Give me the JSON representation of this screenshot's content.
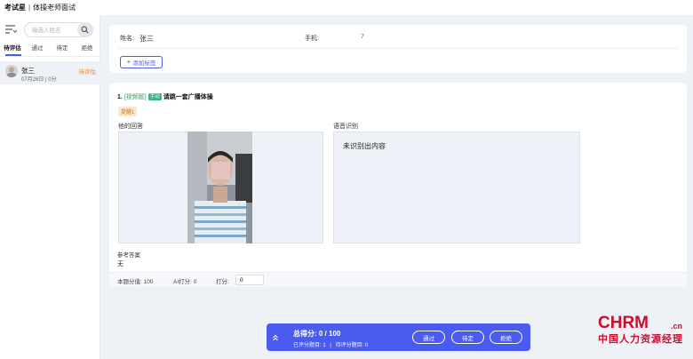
{
  "header": {
    "app_title": "考试星",
    "separator": "|",
    "exam_title": "体操老师面试"
  },
  "sidebar": {
    "search_placeholder": "输选人姓名",
    "tabs": [
      {
        "label": "待评估"
      },
      {
        "label": "通过"
      },
      {
        "label": "待定"
      },
      {
        "label": "拒绝"
      }
    ],
    "candidates": [
      {
        "name": "张三",
        "date": "07月26日",
        "divider": "|",
        "count": "0分",
        "status": "待评估"
      }
    ]
  },
  "profile": {
    "name_label": "姓名:",
    "name_value": "张三",
    "phone_label": "手机:",
    "phone_value": "7",
    "add_tag_label": "添加标签"
  },
  "question": {
    "number": "1.",
    "type": "[视频题]",
    "badge": "手动",
    "text": "请跳一套广播体操",
    "hint_tag": "提醒1",
    "answer_label": "他的回答",
    "asr_label": "语音识别",
    "asr_text": "未识别出内容",
    "ref_label": "参考答案",
    "ref_value": "无",
    "points_label": "本题分值: 100",
    "ai_label": "AI打分: 0",
    "score_label": "打分:",
    "score_value": "0"
  },
  "footer": {
    "total_label": "总得分: 0 / 100",
    "scored_label": "已评分题目: 1",
    "divider": "|",
    "unscored_label": "待评分题目: 0",
    "pass_label": "通过",
    "pending_label": "待定",
    "reject_label": "拒绝"
  },
  "watermark": {
    "brand": "CHRM",
    "domain": ".cn",
    "tagline": "中国人力资源经理"
  },
  "colors": {
    "accent": "#4a5cf0",
    "status_pending": "#f08a24",
    "brand_red": "#c8102e"
  }
}
